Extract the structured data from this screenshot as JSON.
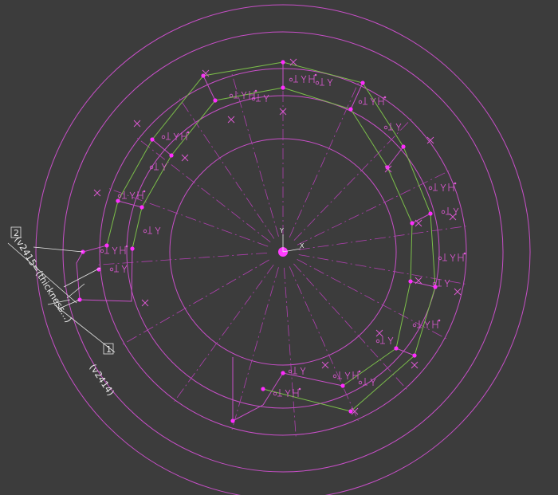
{
  "colors": {
    "background": "#3c3c3c",
    "geometry": "#c84fc8",
    "construction": "#b040b0",
    "fully_defined": "#7cbf4a",
    "point": "#ff2cff",
    "constraint": "#e05ad6",
    "dimension": "#e8e8e8",
    "origin": "#ff3cff"
  },
  "origin": {
    "y_label": "Y",
    "x_label": "X"
  },
  "dimensions": [
    {
      "id": "dim-1",
      "number": "1",
      "expression": "(v2414)"
    },
    {
      "id": "dim-2",
      "number": "2",
      "expression": "(v2415=(thickness...)"
    }
  ],
  "constraint_icons": [
    "coincident-icon",
    "tangent-icon",
    "horizontal-icon",
    "parallel-icon",
    "fix-icon"
  ]
}
